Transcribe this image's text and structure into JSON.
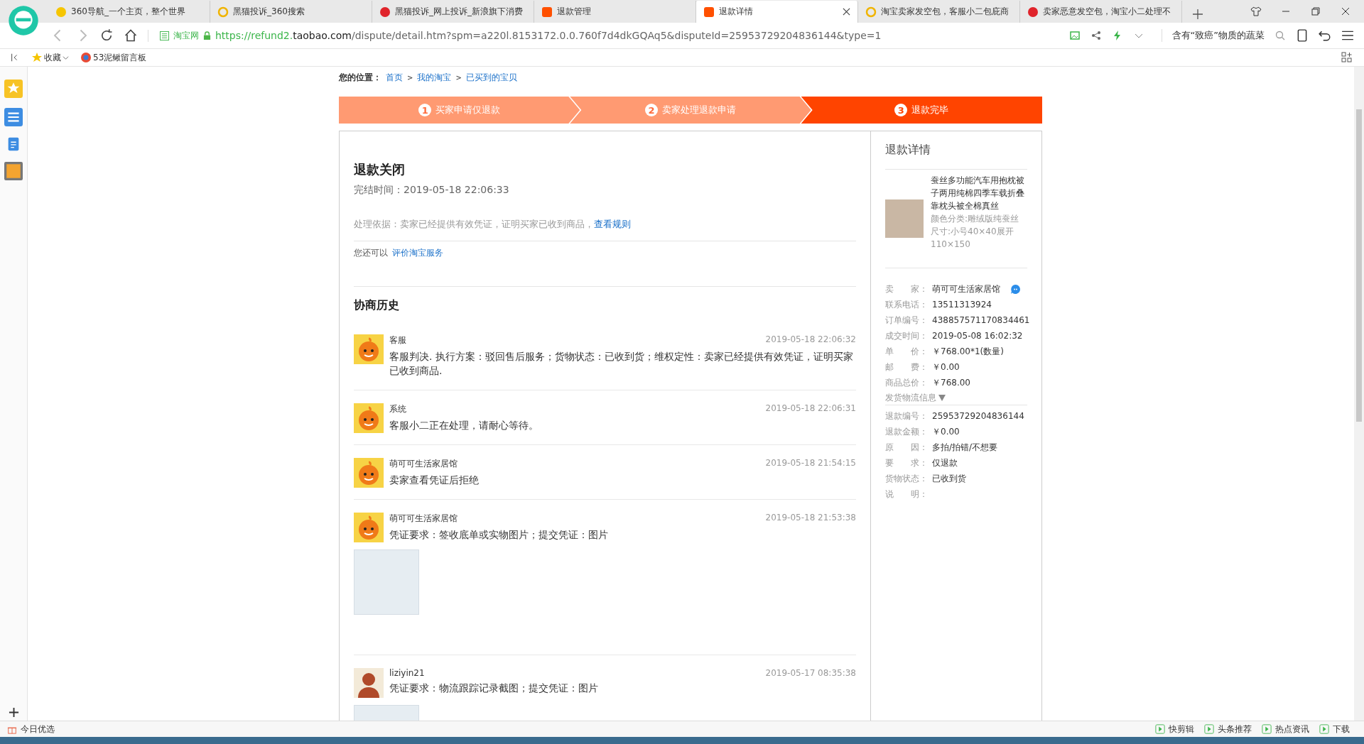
{
  "browser": {
    "tabs": [
      {
        "title": "360导航_一个主页，整个世界",
        "selected": false
      },
      {
        "title": "黑猫投诉_360搜索",
        "selected": false
      },
      {
        "title": "黑猫投诉_网上投诉_新浪旗下消费",
        "selected": false
      },
      {
        "title": "退款管理",
        "selected": false
      },
      {
        "title": "退款详情",
        "selected": true
      },
      {
        "title": "淘宝卖家发空包，客服小二包庇商",
        "selected": false
      },
      {
        "title": "卖家恶意发空包，淘宝小二处理不",
        "selected": false
      }
    ],
    "site_badge": "淘宝网",
    "url_start": "https://refund2.",
    "url_domain": "taobao.com",
    "url_rest": "/dispute/detail.htm?spm=a220l.8153172.0.0.760f7d4dkGQAq5&disputeId=25953729204836144&type=1",
    "search": "含有“致癌”物质的蔬菜",
    "bookmarks": [
      "收藏",
      "53泥鳅留言板"
    ]
  },
  "breadcrumb": {
    "label": "您的位置：",
    "separator": ">",
    "links": [
      "首页",
      "我的淘宝",
      "已买到的宝贝"
    ]
  },
  "steps": [
    {
      "number": "1",
      "label": "买家申请仅退款",
      "selected": false
    },
    {
      "number": "2",
      "label": "卖家处理退款申请",
      "selected": false
    },
    {
      "number": "3",
      "label": "退款完毕",
      "selected": true
    }
  ],
  "status": {
    "title": "退款关闭",
    "finish_label": "完结时间：",
    "finish_time": "2019-05-18 22:06:33",
    "basis": "处理依据：卖家已经提供有效凭证，证明买家已收到商品，",
    "rule_link": "查看规则",
    "also_label": "您还可以",
    "also_link": "评价淘宝服务"
  },
  "history": {
    "title": "协商历史",
    "entries": [
      {
        "author": "客服",
        "kind": "mascot",
        "time": "2019-05-18 22:06:32",
        "message": "客服判决. 执行方案：驳回售后服务；货物状态：已收到货；维权定性：卖家已经提供有效凭证，证明买家已收到商品.",
        "attachment": false
      },
      {
        "author": "系统",
        "kind": "mascot",
        "time": "2019-05-18 22:06:31",
        "message": "客服小二正在处理，请耐心等待。",
        "attachment": false
      },
      {
        "author": "萌可可生活家居馆",
        "kind": "mascot",
        "time": "2019-05-18 21:54:15",
        "message": "卖家查看凭证后拒绝",
        "attachment": false
      },
      {
        "author": "萌可可生活家居馆",
        "kind": "mascot",
        "time": "2019-05-18 21:53:38",
        "message": "凭证要求：签收底单或实物图片；提交凭证：图片",
        "attachment": true
      },
      {
        "author": "liziyin21",
        "kind": "user",
        "time": "2019-05-17 08:35:38",
        "message": "凭证要求：物流跟踪记录截图；提交凭证：图片",
        "attachment": true
      }
    ]
  },
  "detail": {
    "title": "退款详情",
    "product": {
      "name": "蚕丝多功能汽车用抱枕被子两用纯棉四季车载折叠靠枕头被全棉真丝",
      "specs": [
        "颜色分类:雕绒版纯蚕丝",
        "尺寸:小号40×40展开110×150"
      ]
    },
    "order_fields": [
      {
        "label": "卖　　家：",
        "value": "萌可可生活家居馆",
        "kind": "seller"
      },
      {
        "label": "联系电话：",
        "value": "13511313924",
        "kind": "text"
      },
      {
        "label": "订单编号：",
        "value": "438857571170834461",
        "kind": "link"
      },
      {
        "label": "成交时间：",
        "value": "2019-05-08 16:02:32",
        "kind": "text"
      },
      {
        "label": "单　　价：",
        "value": "￥768.00*1(数量)",
        "kind": "text"
      },
      {
        "label": "邮　　费：",
        "value": "￥0.00",
        "kind": "text"
      },
      {
        "label": "商品总价：",
        "value": "￥768.00",
        "kind": "text"
      }
    ],
    "logistics": "发货物流信息",
    "refund_fields": [
      {
        "label": "退款编号：",
        "value": "25953729204836144"
      },
      {
        "label": "退款金额：",
        "value": "￥0.00"
      },
      {
        "label": "原　　因：",
        "value": "多拍/拍错/不想要"
      },
      {
        "label": "要　　求：",
        "value": "仅退款"
      },
      {
        "label": "货物状态：",
        "value": "已收到货"
      },
      {
        "label": "说　　明："
      }
    ]
  },
  "status_bar": {
    "left": "今日优选",
    "right": [
      "快剪辑",
      "头条推荐",
      "热点资讯",
      "下载"
    ]
  }
}
